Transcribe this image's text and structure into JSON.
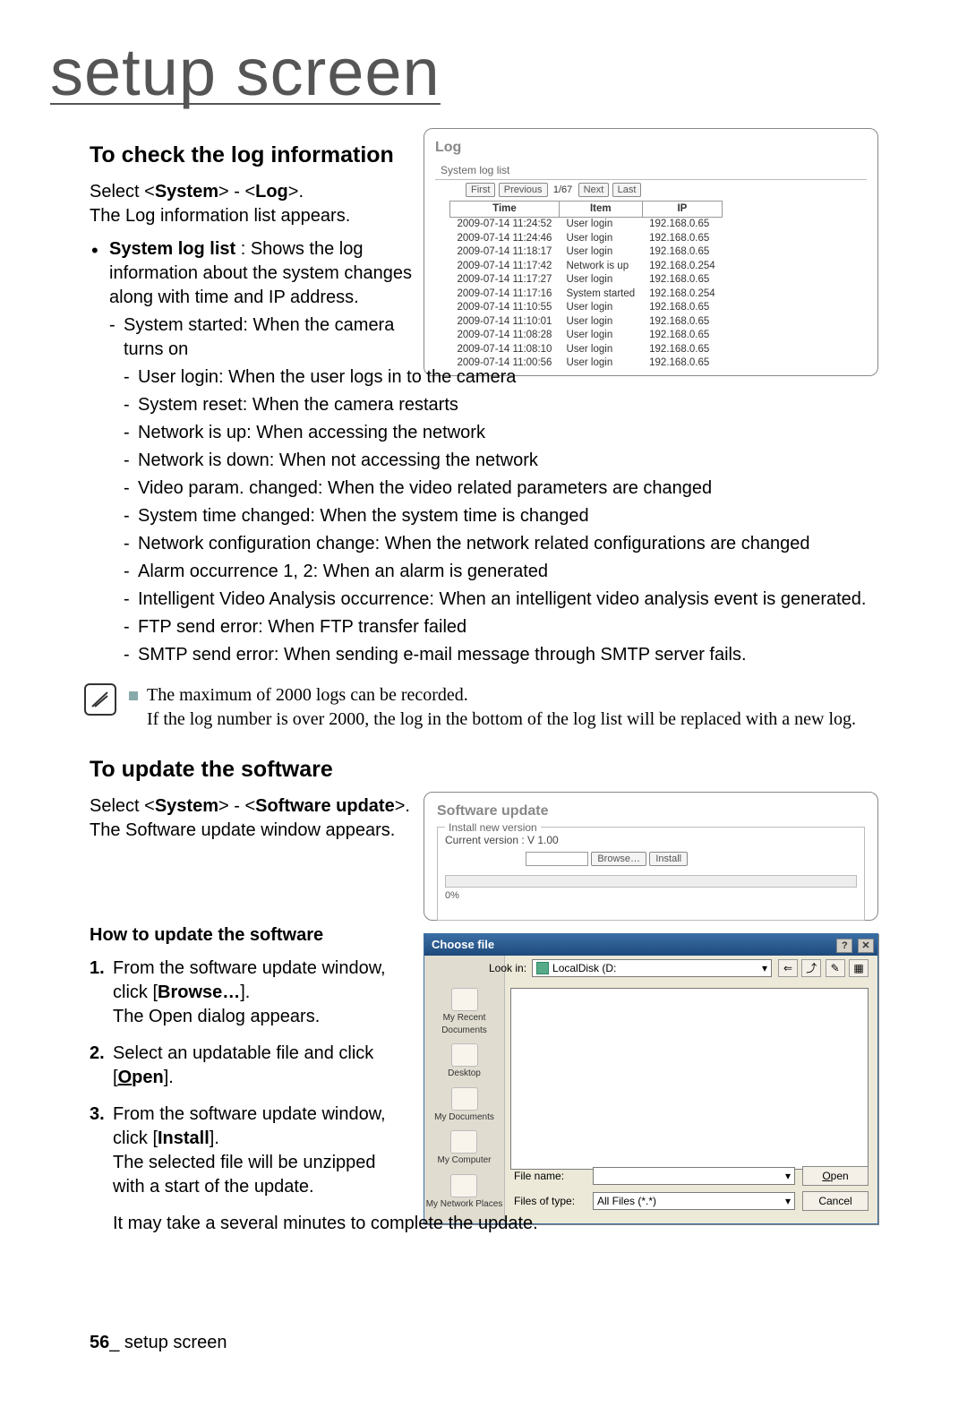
{
  "page": {
    "title": "setup screen",
    "footer_page": "56",
    "footer_text": "_ setup screen"
  },
  "section_log": {
    "heading": "To check the log information",
    "select_prefix": "Select <",
    "system": "System",
    "sep": "> - <",
    "log": "Log",
    "select_suffix": ">.",
    "appear": "The Log information list appears.",
    "bullet_label": "System log list",
    "bullet_desc": " : Shows the log information about the system changes along with time and IP address.",
    "items": [
      "System started: When the camera turns on",
      "User login: When the user logs in to the camera",
      "System reset: When the camera restarts",
      "Network is up: When accessing the network",
      "Network is down: When not accessing the network",
      "Video param. changed: When the video related parameters are changed",
      "System time changed: When the system time is changed",
      "Network configuration change: When the network related configurations are changed",
      "Alarm occurrence 1, 2: When an alarm is generated",
      "Intelligent Video Analysis occurrence: When an intelligent video analysis event is generated.",
      "FTP send error: When FTP transfer failed",
      "SMTP send error: When sending e-mail message through SMTP server fails."
    ],
    "note1": "The maximum of 2000 logs can be recorded.",
    "note2": "If the log number is over 2000, the log in the bottom of the log list will be replaced with a new log."
  },
  "log_panel": {
    "title": "Log",
    "fieldset": "System log list",
    "first": "First",
    "prev": "Previous",
    "page": "1/67",
    "next": "Next",
    "last": "Last",
    "col_time": "Time",
    "col_item": "Item",
    "col_ip": "IP",
    "rows": [
      {
        "t": "2009-07-14 11:24:52",
        "i": "User login",
        "p": "192.168.0.65"
      },
      {
        "t": "2009-07-14 11:24:46",
        "i": "User login",
        "p": "192.168.0.65"
      },
      {
        "t": "2009-07-14 11:18:17",
        "i": "User login",
        "p": "192.168.0.65"
      },
      {
        "t": "2009-07-14 11:17:42",
        "i": "Network is up",
        "p": "192.168.0.254"
      },
      {
        "t": "2009-07-14 11:17:27",
        "i": "User login",
        "p": "192.168.0.65"
      },
      {
        "t": "2009-07-14 11:17:16",
        "i": "System started",
        "p": "192.168.0.254"
      },
      {
        "t": "2009-07-14 11:10:55",
        "i": "User login",
        "p": "192.168.0.65"
      },
      {
        "t": "2009-07-14 11:10:01",
        "i": "User login",
        "p": "192.168.0.65"
      },
      {
        "t": "2009-07-14 11:08:28",
        "i": "User login",
        "p": "192.168.0.65"
      },
      {
        "t": "2009-07-14 11:08:10",
        "i": "User login",
        "p": "192.168.0.65"
      },
      {
        "t": "2009-07-14 11:00:56",
        "i": "User login",
        "p": "192.168.0.65"
      }
    ]
  },
  "section_update": {
    "heading": "To update the software",
    "select_prefix": "Select <",
    "system": "System",
    "sep": "> - <",
    "sw": "Software update",
    "select_suffix": ">.",
    "appear": "The Software update window appears.",
    "how_heading": "How to update the software",
    "step1a": "From the software update window, click [",
    "step1b": "Browse…",
    "step1c": "].",
    "step1d": "The Open dialog appears.",
    "step2a": "Select an updatable file and click [",
    "step2b_underline_letter": "O",
    "step2b_rest": "pen",
    "step2c": "].",
    "step3a": "From the software update window, click [",
    "step3b": "Install",
    "step3c": "].",
    "step3d": "The selected file will be unzipped with a start of the update.",
    "step3e": "It may take a several minutes to complete the update."
  },
  "sw_panel": {
    "title": "Software update",
    "legend": "Install new version",
    "version": "Current version : V 1.00",
    "browse": "Browse…",
    "install": "Install",
    "pct": "0%"
  },
  "dlg": {
    "title": "Choose file",
    "lookin": "Look in:",
    "drive": "LocalDisk (D:",
    "places": [
      "My Recent Documents",
      "Desktop",
      "My Documents",
      "My Computer",
      "My Network Places"
    ],
    "filename_label": "File name:",
    "filetype_label": "Files of type:",
    "filetype_value": "All Files (*.*)",
    "open": "Open",
    "cancel": "Cancel"
  }
}
